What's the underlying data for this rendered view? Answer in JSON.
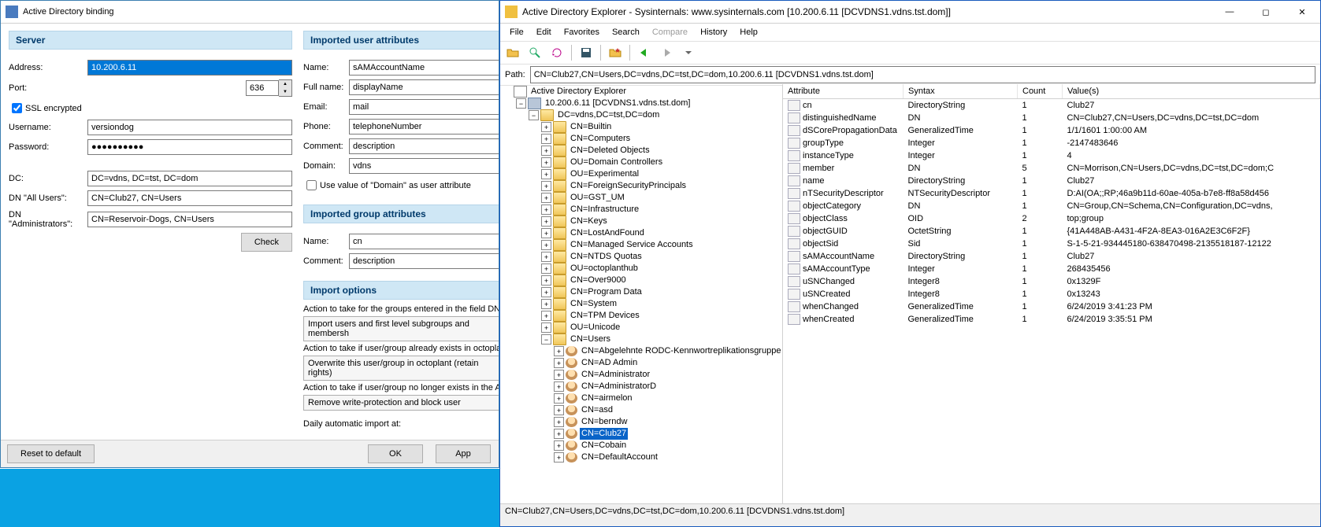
{
  "left": {
    "title": "Active Directory binding",
    "server_header": "Server",
    "address_label": "Address:",
    "address_value": "10.200.6.11",
    "port_label": "Port:",
    "port_value": "636",
    "ssl_label": "SSL encrypted",
    "ssl_checked": true,
    "username_label": "Username:",
    "username_value": "versiondog",
    "password_label": "Password:",
    "password_value": "●●●●●●●●●●",
    "dc_label": "DC:",
    "dc_value": "DC=vdns, DC=tst, DC=dom",
    "dn_all_label": "DN \"All Users\":",
    "dn_all_value": "CN=Club27, CN=Users",
    "dn_admin_label": "DN \"Administrators\":",
    "dn_admin_value": "CN=Reservoir-Dogs, CN=Users",
    "check_button": "Check",
    "iua_header": "Imported user attributes",
    "iua": {
      "name_l": "Name:",
      "name_v": "sAMAccountName",
      "full_l": "Full name:",
      "full_v": "displayName",
      "email_l": "Email:",
      "email_v": "mail",
      "phone_l": "Phone:",
      "phone_v": "telephoneNumber",
      "comment_l": "Comment:",
      "comment_v": "description",
      "domain_l": "Domain:",
      "domain_v": "vdns",
      "usedom_label": "Use value of \"Domain\" as user attribute"
    },
    "iga_header": "Imported group attributes",
    "iga": {
      "name_l": "Name:",
      "name_v": "cn",
      "comment_l": "Comment:",
      "comment_v": "description"
    },
    "opts_header": "Import options",
    "opt_groups_l": "Action to take for the groups entered in the field DN \"",
    "opt_groups_v": "Import users and first level subgroups and membersh",
    "opt_exists_l": "Action to take if user/group already exists in octoplan",
    "opt_exists_v": "Overwrite this user/group in octoplant (retain rights)",
    "opt_gone_l": "Action to take if user/group no longer exists in the Ac",
    "opt_gone_v": "Remove write-protection and block user",
    "daily_l": "Daily automatic import at:",
    "reset": "Reset to default",
    "ok": "OK",
    "apply": "App"
  },
  "right": {
    "title": "Active Directory Explorer - Sysinternals: www.sysinternals.com [10.200.6.11 [DCVDNS1.vdns.tst.dom]]",
    "menu": [
      "File",
      "Edit",
      "Favorites",
      "Search",
      "Compare",
      "History",
      "Help"
    ],
    "menu_disabled_index": 4,
    "path_l": "Path:",
    "path_v": "CN=Club27,CN=Users,DC=vdns,DC=tst,DC=dom,10.200.6.11 [DCVDNS1.vdns.tst.dom]",
    "status": "CN=Club27,CN=Users,DC=vdns,DC=tst,DC=dom,10.200.6.11 [DCVDNS1.vdns.tst.dom]",
    "tree_root": "Active Directory Explorer",
    "tree_server": "10.200.6.11 [DCVDNS1.vdns.tst.dom]",
    "tree_dc": "DC=vdns,DC=tst,DC=dom",
    "containers": [
      "CN=Builtin",
      "CN=Computers",
      "CN=Deleted Objects",
      "OU=Domain Controllers",
      "OU=Experimental",
      "CN=ForeignSecurityPrincipals",
      "OU=GST_UM",
      "CN=Infrastructure",
      "CN=Keys",
      "CN=LostAndFound",
      "CN=Managed Service Accounts",
      "CN=NTDS Quotas",
      "OU=octoplanthub",
      "CN=Over9000",
      "CN=Program Data",
      "CN=System",
      "CN=TPM Devices",
      "OU=Unicode"
    ],
    "users_label": "CN=Users",
    "user_children": [
      "CN=Abgelehnte RODC-Kennwortreplikationsgruppe",
      "CN=AD Admin",
      "CN=Administrator",
      "CN=AdministratorD",
      "CN=airmelon",
      "CN=asd",
      "CN=berndw",
      "CN=Club27",
      "CN=Cobain",
      "CN=DefaultAccount"
    ],
    "selected_user_index": 7,
    "cols": [
      "Attribute",
      "Syntax",
      "Count",
      "Value(s)"
    ],
    "attrs": [
      {
        "a": "cn",
        "s": "DirectoryString",
        "c": "1",
        "v": "Club27"
      },
      {
        "a": "distinguishedName",
        "s": "DN",
        "c": "1",
        "v": "CN=Club27,CN=Users,DC=vdns,DC=tst,DC=dom"
      },
      {
        "a": "dSCorePropagationData",
        "s": "GeneralizedTime",
        "c": "1",
        "v": "1/1/1601 1:00:00 AM"
      },
      {
        "a": "groupType",
        "s": "Integer",
        "c": "1",
        "v": "-2147483646"
      },
      {
        "a": "instanceType",
        "s": "Integer",
        "c": "1",
        "v": "4"
      },
      {
        "a": "member",
        "s": "DN",
        "c": "5",
        "v": "CN=Morrison,CN=Users,DC=vdns,DC=tst,DC=dom;C"
      },
      {
        "a": "name",
        "s": "DirectoryString",
        "c": "1",
        "v": "Club27"
      },
      {
        "a": "nTSecurityDescriptor",
        "s": "NTSecurityDescriptor",
        "c": "1",
        "v": "D:AI(OA;;RP;46a9b11d-60ae-405a-b7e8-ff8a58d456"
      },
      {
        "a": "objectCategory",
        "s": "DN",
        "c": "1",
        "v": "CN=Group,CN=Schema,CN=Configuration,DC=vdns,"
      },
      {
        "a": "objectClass",
        "s": "OID",
        "c": "2",
        "v": "top;group"
      },
      {
        "a": "objectGUID",
        "s": "OctetString",
        "c": "1",
        "v": "{41A448AB-A431-4F2A-8EA3-016A2E3C6F2F}"
      },
      {
        "a": "objectSid",
        "s": "Sid",
        "c": "1",
        "v": "S-1-5-21-934445180-638470498-2135518187-12122"
      },
      {
        "a": "sAMAccountName",
        "s": "DirectoryString",
        "c": "1",
        "v": "Club27"
      },
      {
        "a": "sAMAccountType",
        "s": "Integer",
        "c": "1",
        "v": "268435456"
      },
      {
        "a": "uSNChanged",
        "s": "Integer8",
        "c": "1",
        "v": "0x1329F"
      },
      {
        "a": "uSNCreated",
        "s": "Integer8",
        "c": "1",
        "v": "0x13243"
      },
      {
        "a": "whenChanged",
        "s": "GeneralizedTime",
        "c": "1",
        "v": "6/24/2019 3:41:23 PM"
      },
      {
        "a": "whenCreated",
        "s": "GeneralizedTime",
        "c": "1",
        "v": "6/24/2019 3:35:51 PM"
      }
    ]
  }
}
